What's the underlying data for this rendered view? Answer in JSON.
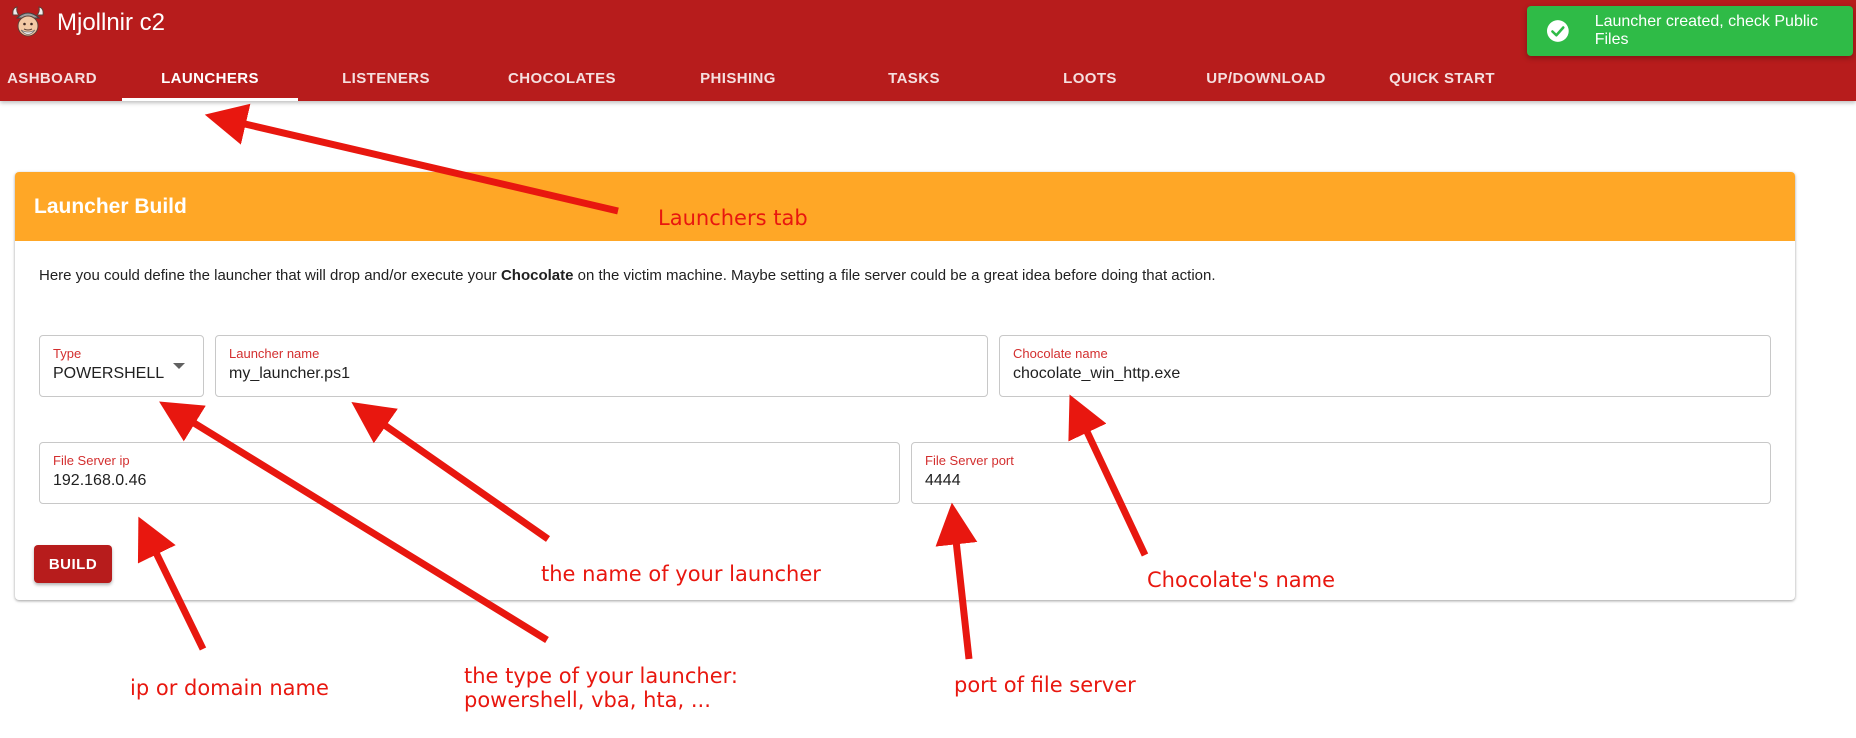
{
  "app": {
    "title": "Mjollnir c2",
    "logo_icon": "viking-helmet-face-icon"
  },
  "tabs": [
    {
      "label": "ASHBOARD",
      "active": false
    },
    {
      "label": "LAUNCHERS",
      "active": true
    },
    {
      "label": "LISTENERS",
      "active": false
    },
    {
      "label": "CHOCOLATES",
      "active": false
    },
    {
      "label": "PHISHING",
      "active": false
    },
    {
      "label": "TASKS",
      "active": false
    },
    {
      "label": "LOOTS",
      "active": false
    },
    {
      "label": "UP/DOWNLOAD",
      "active": false
    },
    {
      "label": "QUICK START",
      "active": false
    }
  ],
  "toast": {
    "icon": "check-circle-icon",
    "message": "Launcher created, check Public Files"
  },
  "card": {
    "title": "Launcher Build",
    "description": {
      "before": "Here you could define the launcher that will drop and/or execute your ",
      "bold": "Chocolate",
      "after": " on the victim machine. Maybe setting a file server could be a great idea before doing that action."
    },
    "fields": {
      "type": {
        "label": "Type",
        "value": "POWERSHELL",
        "icon": "dropdown-caret-icon"
      },
      "launcher_name": {
        "label": "Launcher name",
        "value": "my_launcher.ps1"
      },
      "chocolate_name": {
        "label": "Chocolate name",
        "value": "chocolate_win_http.exe"
      },
      "file_server_ip": {
        "label": "File Server ip",
        "value": "192.168.0.46"
      },
      "file_server_port": {
        "label": "File Server port",
        "value": "4444"
      }
    },
    "build_label": "BUILD"
  },
  "annotations": {
    "launchers_tab": "Launchers tab",
    "launcher_name": "the name of your launcher",
    "chocolate_name": "Chocolate's name",
    "ip": "ip or domain name",
    "type_line1": "the type of your launcher:",
    "type_line2": "powershell, vba, hta, ...",
    "port": "port of file server"
  },
  "colors": {
    "appbar": "#b71c1c",
    "card_header": "#ffa726",
    "toast": "#2fbb47",
    "field_label": "#d32f2f",
    "annotation": "#e8170f"
  }
}
